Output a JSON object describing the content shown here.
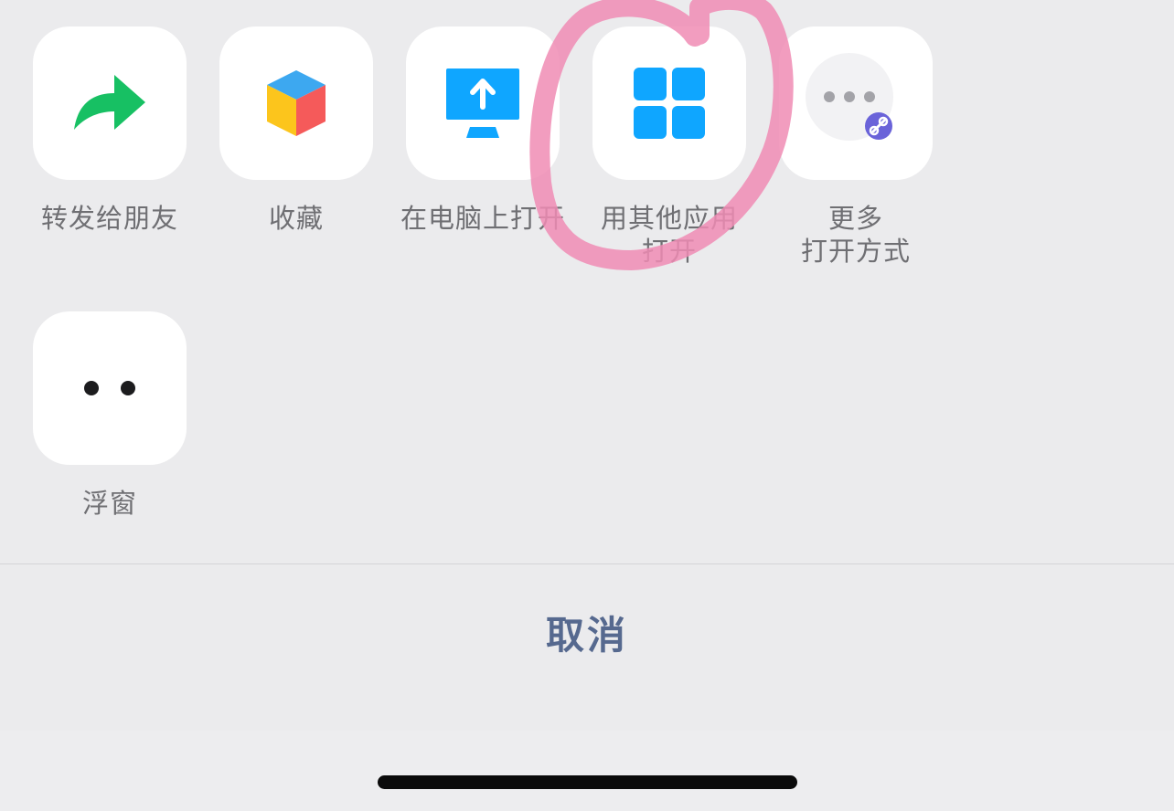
{
  "actions": [
    {
      "id": "forward",
      "label_lines": [
        "转发给朋友"
      ],
      "icon": "forward-arrow-icon"
    },
    {
      "id": "favorite",
      "label_lines": [
        "收藏"
      ],
      "icon": "favorite-cube-icon"
    },
    {
      "id": "open-on-pc",
      "label_lines": [
        "在电脑上打开"
      ],
      "icon": "monitor-upload-icon"
    },
    {
      "id": "open-with-other-app",
      "label_lines": [
        "用其他应用",
        "打开"
      ],
      "icon": "app-grid-icon"
    },
    {
      "id": "more-open-options",
      "label_lines": [
        "更多",
        "打开方式"
      ],
      "icon": "more-dots-icon"
    },
    {
      "id": "float-window",
      "label_lines": [
        "浮窗"
      ],
      "icon": "float-window-dots-icon"
    }
  ],
  "cancel": {
    "label": "取消"
  },
  "colors": {
    "background": "#ebebed",
    "tile": "#ffffff",
    "label_text": "#6f6f73",
    "cancel_text": "#56698f",
    "forward_green": "#17c063",
    "app_blue": "#0fa6ff",
    "cube_blue": "#3da8f0",
    "cube_yellow": "#fcc51c",
    "cube_red": "#f55a5a",
    "mini_program_purple": "#6a63d9",
    "annotation_pink": "#f08cb4"
  }
}
